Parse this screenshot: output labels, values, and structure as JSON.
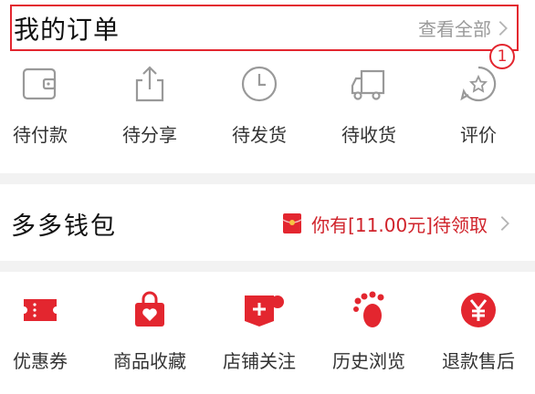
{
  "orders": {
    "title": "我的订单",
    "view_all": "查看全部",
    "badge": "1",
    "items": [
      {
        "label": "待付款",
        "icon": "wallet-icon"
      },
      {
        "label": "待分享",
        "icon": "share-icon"
      },
      {
        "label": "待发货",
        "icon": "clock-icon"
      },
      {
        "label": "待收货",
        "icon": "truck-icon"
      },
      {
        "label": "评价",
        "icon": "star-bubble-icon"
      }
    ]
  },
  "wallet": {
    "title": "多多钱包",
    "message": "你有[11.00元]待领取",
    "icon": "red-envelope-icon"
  },
  "tools": {
    "items": [
      {
        "label": "优惠券",
        "icon": "coupon-icon"
      },
      {
        "label": "商品收藏",
        "icon": "favorite-bag-icon"
      },
      {
        "label": "店铺关注",
        "icon": "store-follow-icon"
      },
      {
        "label": "历史浏览",
        "icon": "footprint-icon"
      },
      {
        "label": "退款售后",
        "icon": "refund-yen-icon"
      }
    ]
  },
  "colors": {
    "accent": "#e3262f",
    "text_gray": "#9a9a9a",
    "divider": "#f2f2f2"
  }
}
